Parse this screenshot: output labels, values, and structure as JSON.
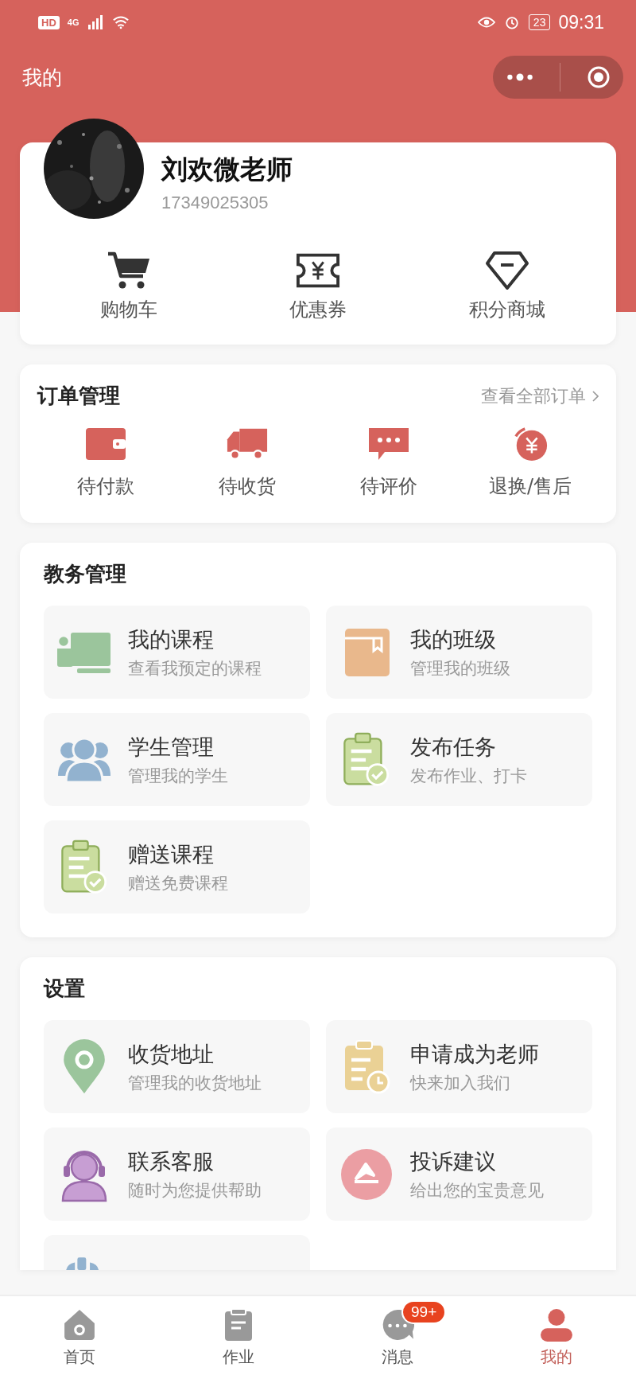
{
  "status_bar": {
    "hd": "HD",
    "network": "4G",
    "battery": "23",
    "time": "09:31"
  },
  "header": {
    "title": "我的"
  },
  "profile": {
    "name": "刘欢微老师",
    "phone": "17349025305",
    "shortcuts": [
      {
        "label": "购物车"
      },
      {
        "label": "优惠券"
      },
      {
        "label": "积分商城"
      }
    ]
  },
  "orders": {
    "title": "订单管理",
    "link": "查看全部订单",
    "items": [
      {
        "label": "待付款"
      },
      {
        "label": "待收货"
      },
      {
        "label": "待评价"
      },
      {
        "label": "退换/售后"
      }
    ]
  },
  "sections": [
    {
      "title": "教务管理",
      "tiles": [
        {
          "kind": "full",
          "title": "我的课程",
          "subtitle": "查看我预定的课程"
        },
        {
          "kind": "full",
          "title": "我的班级",
          "subtitle": "管理我的班级"
        },
        {
          "kind": "full",
          "title": "学生管理",
          "subtitle": "管理我的学生"
        },
        {
          "kind": "full",
          "title": "发布任务",
          "subtitle": "发布作业、打卡"
        },
        {
          "kind": "full",
          "title": "赠送课程",
          "subtitle": "赠送免费课程"
        }
      ]
    },
    {
      "title": "设置",
      "tiles": [
        {
          "kind": "full",
          "title": "收货地址",
          "subtitle": "管理我的收货地址"
        },
        {
          "kind": "full",
          "title": "申请成为老师",
          "subtitle": "快来加入我们"
        },
        {
          "kind": "full",
          "title": "联系客服",
          "subtitle": "随时为您提供帮助"
        },
        {
          "kind": "full",
          "title": "投诉建议",
          "subtitle": "给出您的宝贵意见"
        },
        {
          "kind": "cut"
        }
      ]
    }
  ],
  "tab_bar": [
    {
      "label": "首页",
      "selected": false
    },
    {
      "label": "作业",
      "selected": false
    },
    {
      "label": "消息",
      "selected": false,
      "badge": "99+"
    },
    {
      "label": "我的",
      "selected": true
    }
  ]
}
